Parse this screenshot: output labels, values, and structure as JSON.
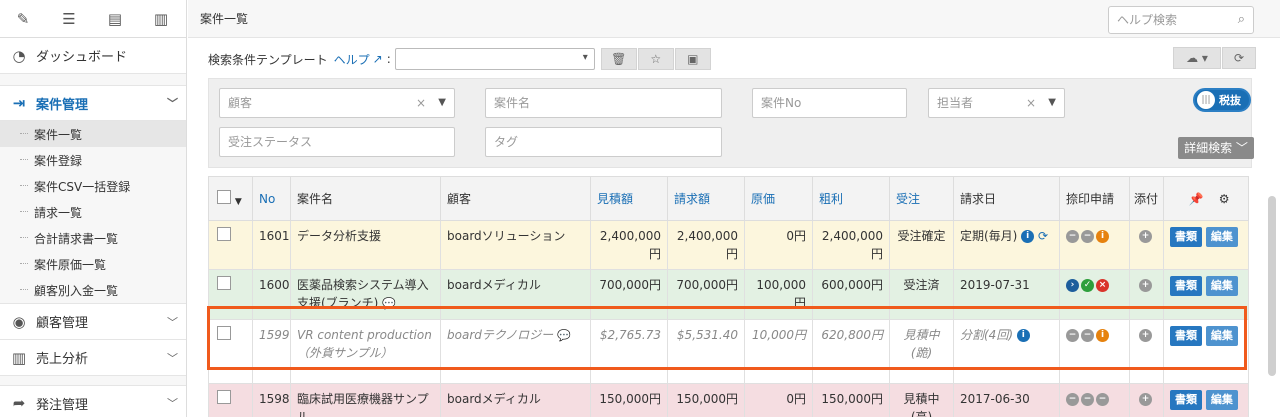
{
  "sidebar": {
    "tools": [
      "pencil-icon",
      "list-icon",
      "table-list-icon",
      "bar-chart-icon"
    ],
    "dashboard": "ダッシュボード",
    "cases": "案件管理",
    "sub_items": [
      "案件一覧",
      "案件登録",
      "案件CSV一括登録",
      "請求一覧",
      "合計請求書一覧",
      "案件原価一覧",
      "顧客別入金一覧"
    ],
    "customers": "顧客管理",
    "sales": "売上分析",
    "orders": "発注管理"
  },
  "header": {
    "title": "案件一覧",
    "help_search": "ヘルプ検索"
  },
  "template": {
    "label": "検索条件テンプレート",
    "help": "ヘルプ",
    "colon": ":"
  },
  "search": {
    "customer": "顧客",
    "case_name": "案件名",
    "case_no": "案件No",
    "assignee": "担当者",
    "tax_toggle": "税抜",
    "order_status": "受注ステータス",
    "tag": "タグ",
    "detail": "詳細検索"
  },
  "table": {
    "headers": [
      "No",
      "案件名",
      "顧客",
      "見積額",
      "請求額",
      "原価",
      "粗利",
      "受注",
      "請求日",
      "捺印申請",
      "添付"
    ],
    "rows": [
      {
        "no": "1601",
        "name": "データ分析支援",
        "customer": "boardソリューション",
        "estimate": "2,400,000円",
        "invoice": "2,400,000円",
        "cost": "0円",
        "profit": "2,400,000円",
        "status": "受注確定",
        "date": "定期(毎月)"
      },
      {
        "no": "1600",
        "name": "医薬品検索システム導入支援(ブランチ)",
        "customer": "boardメディカル",
        "estimate": "700,000円",
        "invoice": "700,000円",
        "cost": "100,000円",
        "profit": "600,000円",
        "status": "受注済",
        "date": "2019-07-31"
      },
      {
        "no": "1599",
        "name": "VR content production（外貨サンプル）",
        "customer": "boardテクノロジー",
        "estimate": "$2,765.73",
        "invoice": "$5,531.40",
        "cost": "10,000円",
        "profit": "620,800円",
        "status": "見積中(跪)",
        "date": "分割(4回)"
      },
      {
        "no": "1598",
        "name": "臨床試用医療機器サンプル",
        "customer": "boardメディカル",
        "estimate": "150,000円",
        "invoice": "150,000円",
        "cost": "0円",
        "profit": "150,000円",
        "status": "見積中(高)",
        "date": "2017-06-30"
      }
    ],
    "btn_docs": "書類",
    "btn_edit": "編集"
  }
}
